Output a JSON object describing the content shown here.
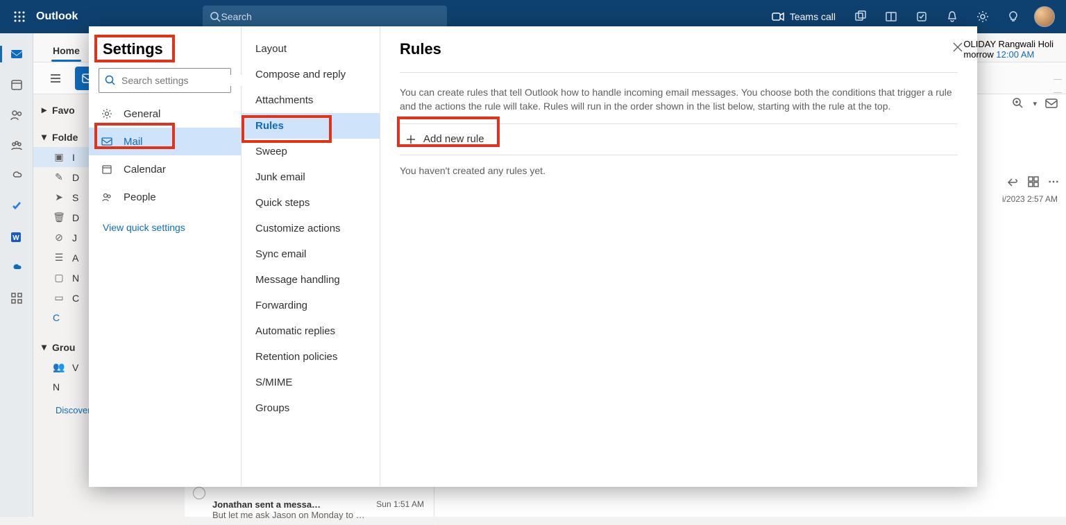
{
  "topbar": {
    "brand": "Outlook",
    "search_placeholder": "Search",
    "teams_call": "Teams call"
  },
  "ribbon": {
    "tabs": [
      {
        "label": "Home"
      }
    ]
  },
  "folderpane": {
    "favorites": "Favo",
    "folders": "Folde",
    "items": [
      "I",
      "D",
      "S",
      "D",
      "J",
      "A",
      "N",
      "C",
      "C"
    ],
    "groups": "Grou",
    "group_items": [
      "V",
      "N"
    ],
    "discover": "Discover groups"
  },
  "msglist": {
    "from": "Jonathan sent a messa…",
    "time": "Sun 1:51 AM",
    "preview": "But let me ask Jason on Monday to …"
  },
  "calpeek": {
    "line1": "OLIDAY Rangwali Holi",
    "line2": "morrow",
    "time": "12:00 AM"
  },
  "reading": {
    "date": "i/2023 2:57 AM"
  },
  "settings": {
    "title": "Settings",
    "search_placeholder": "Search settings",
    "categories": [
      {
        "label": "General"
      },
      {
        "label": "Mail"
      },
      {
        "label": "Calendar"
      },
      {
        "label": "People"
      }
    ],
    "quick": "View quick settings",
    "subitems": [
      "Layout",
      "Compose and reply",
      "Attachments",
      "Rules",
      "Sweep",
      "Junk email",
      "Quick steps",
      "Customize actions",
      "Sync email",
      "Message handling",
      "Forwarding",
      "Automatic replies",
      "Retention policies",
      "S/MIME",
      "Groups"
    ],
    "pane_title": "Rules",
    "desc": "You can create rules that tell Outlook how to handle incoming email messages. You choose both the conditions that trigger a rule and the actions the rule will take. Rules will run in the order shown in the list below, starting with the rule at the top.",
    "add_rule": "Add new rule",
    "empty": "You haven't created any rules yet."
  }
}
